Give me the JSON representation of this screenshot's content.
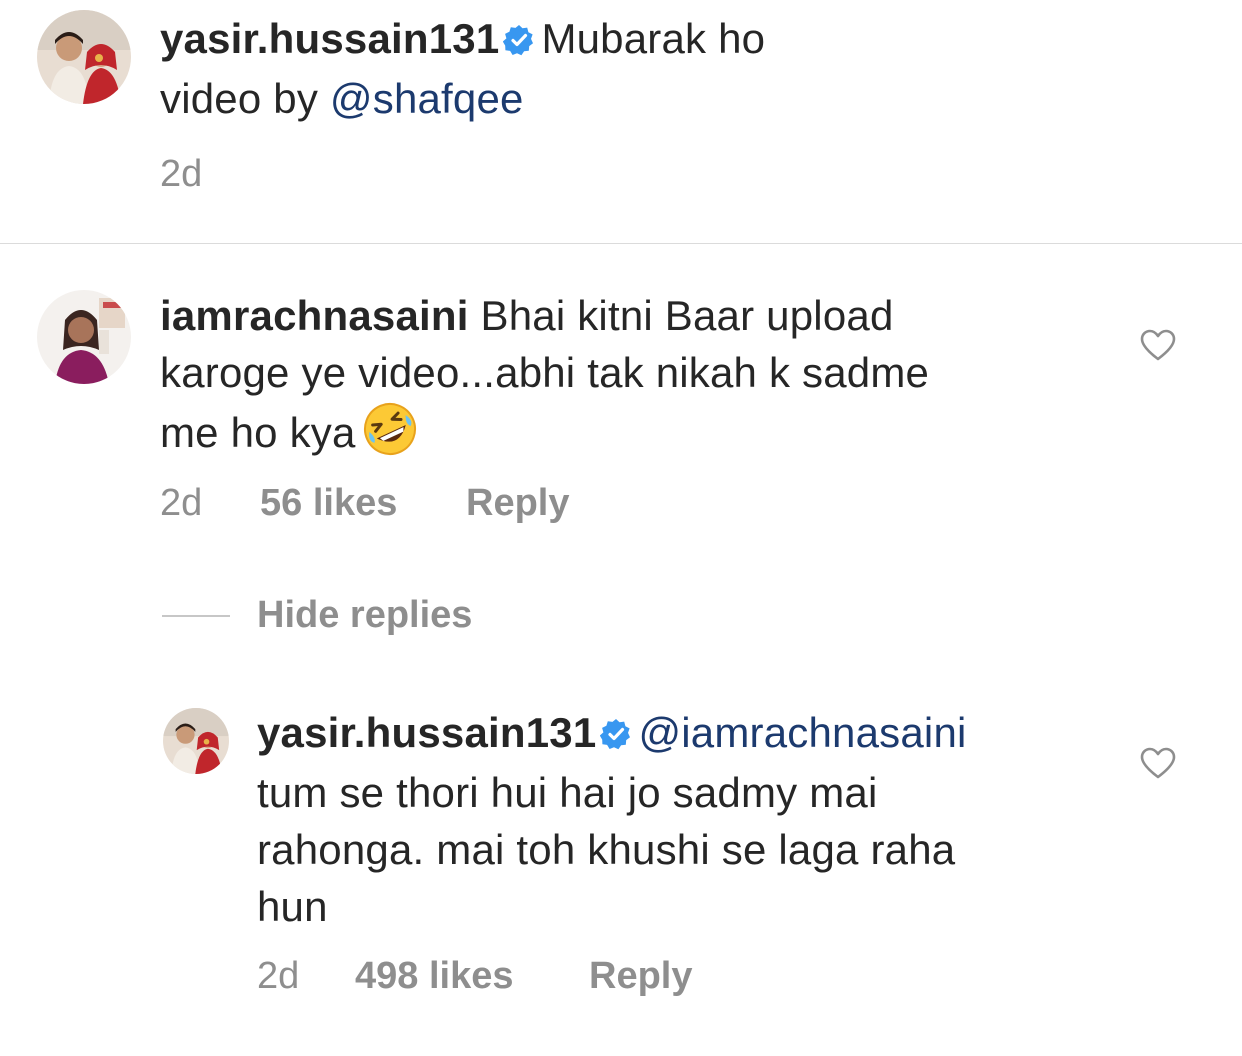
{
  "comment1": {
    "username": "yasir.hussain131",
    "text": "Mubarak ho",
    "line2_prefix": "video by ",
    "mention": "@shafqee",
    "time": "2d"
  },
  "comment2": {
    "username": "iamrachnasaini",
    "text_line1": "Bhai kitni Baar upload",
    "text_line2": "karoge ye video...abhi tak nikah k sadme",
    "text_line3": "me ho kya",
    "emoji": "rolling-on-floor-laughing-emoji",
    "time": "2d",
    "likes": "56 likes",
    "reply": "Reply"
  },
  "replies_toggle": "Hide replies",
  "reply1": {
    "username": "yasir.hussain131",
    "mention": "@iamrachnasaini",
    "text_line2": "tum se thori hui hai jo sadmy mai",
    "text_line3": "rahonga. mai toh khushi se laga raha",
    "text_line4": "hun",
    "time": "2d",
    "likes": "498 likes",
    "reply": "Reply"
  },
  "colors": {
    "verified": "#3897f0",
    "mention": "#1c3a6e",
    "meta": "#8e8e8e",
    "text": "#262626"
  }
}
